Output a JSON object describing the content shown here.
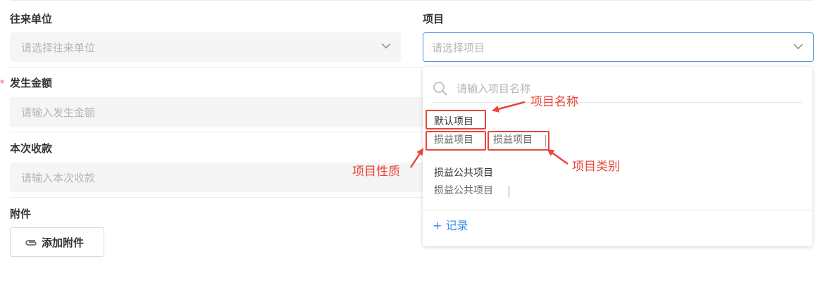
{
  "form": {
    "partner": {
      "label": "往来单位",
      "placeholder": "请选择往来单位"
    },
    "project": {
      "label": "项目",
      "placeholder": "请选择项目"
    },
    "amount": {
      "label": "发生金额",
      "placeholder": "请输入发生金额",
      "required_mark": "*"
    },
    "receipt": {
      "label": "本次收款",
      "placeholder": "请输入本次收款"
    },
    "attachment": {
      "label": "附件",
      "button_label": "添加附件"
    }
  },
  "dropdown": {
    "search_placeholder": "请输入项目名称",
    "items": [
      {
        "name": "默认项目",
        "nature": "损益项目",
        "category": "损益项目"
      },
      {
        "name": "损益公共项目",
        "nature": "损益公共项目",
        "category": ""
      }
    ],
    "add_label": "+ 记录"
  },
  "annotations": {
    "name": "项目名称",
    "nature": "项目性质",
    "category": "项目类别"
  },
  "colors": {
    "accent": "#3a8ee6",
    "annotation": "#e8463b",
    "focus_border": "#4a90e2"
  }
}
